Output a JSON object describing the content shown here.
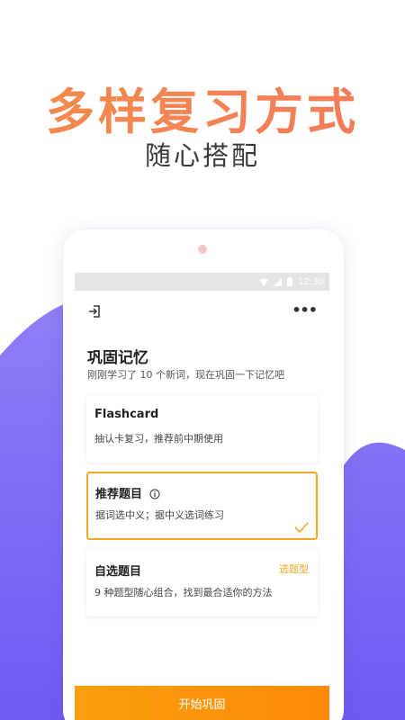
{
  "promo": {
    "headline": "多样复习方式",
    "subheadline": "随心搭配"
  },
  "colors": {
    "accent": "#f7a623",
    "button": "#fb9b0f",
    "headline": "#f5854e",
    "blob": "#7d69f4"
  },
  "statusbar": {
    "time": "12:30",
    "icons": [
      "wifi-icon",
      "signal-icon",
      "battery-icon"
    ]
  },
  "header": {
    "back_icon": "exit-icon",
    "more_icon": "more-dots-icon"
  },
  "main": {
    "title": "巩固记忆",
    "description": "刚刚学习了 10 个新词，现在巩固一下记忆吧"
  },
  "options": [
    {
      "title": "Flashcard",
      "description": "抽认卡复习，推荐前中期使用",
      "selected": false
    },
    {
      "title": "推荐题目",
      "description": "据词选中义；据中义选词练习",
      "selected": true,
      "icon": "info-icon"
    },
    {
      "title": "自选题目",
      "description": "9 种题型随心组合，找到最合适你的方法",
      "selected": false,
      "action": "选题型"
    }
  ],
  "footer": {
    "start_label": "开始巩固"
  }
}
